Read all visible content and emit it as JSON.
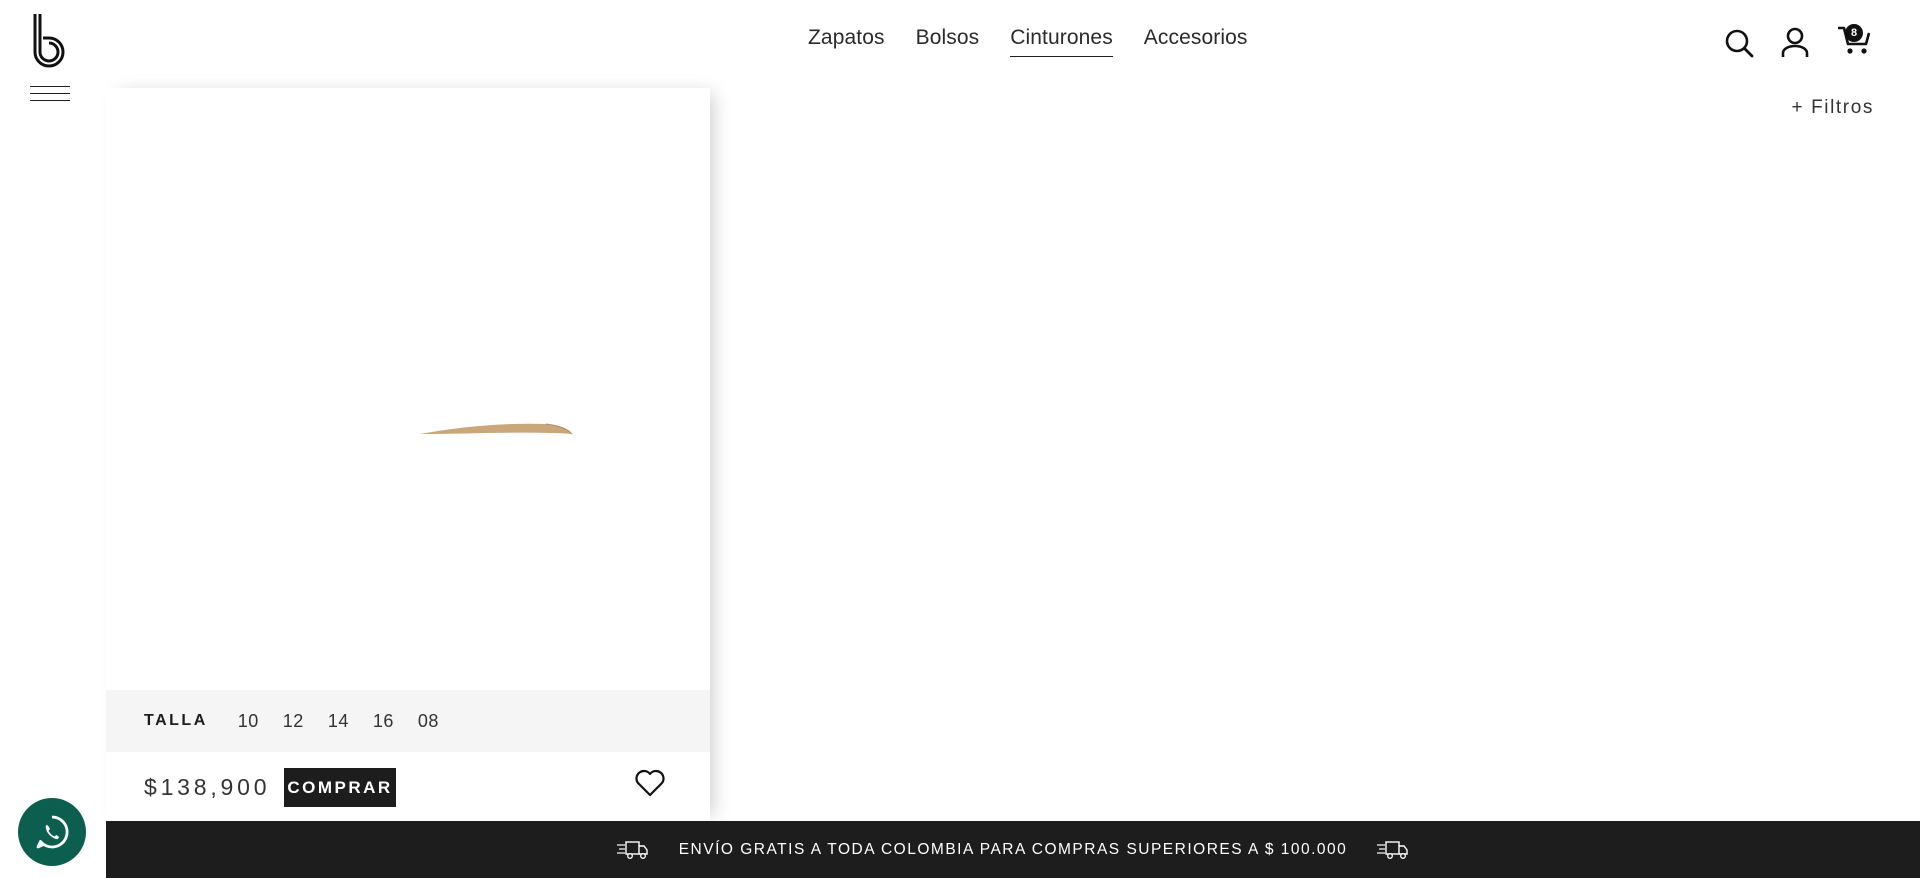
{
  "header": {
    "nav": [
      {
        "label": "Zapatos",
        "active": false
      },
      {
        "label": "Bolsos",
        "active": false
      },
      {
        "label": "Cinturones",
        "active": true
      },
      {
        "label": "Accesorios",
        "active": false
      }
    ],
    "cart_count": "8",
    "icons": [
      "logo-b",
      "hamburger-menu-icon",
      "search-icon",
      "user-icon",
      "cart-icon"
    ]
  },
  "filters_label": "+ Filtros",
  "product": {
    "size_label": "TALLA",
    "sizes": [
      "10",
      "12",
      "14",
      "16",
      "08"
    ],
    "price": "$138,900",
    "buy_label": "COMPRAR",
    "favorite_icon": "heart-icon"
  },
  "banner": {
    "text": "ENVÍO GRATIS A TODA COLOMBIA PARA COMPRAS SUPERIORES A $ 100.000",
    "icon": "truck-icon"
  },
  "colors": {
    "dark": "#1d1d1d",
    "whatsapp": "#0c5e4f",
    "size_bar_bg": "#f5f5f5",
    "product_tan": "#c9a77b"
  }
}
